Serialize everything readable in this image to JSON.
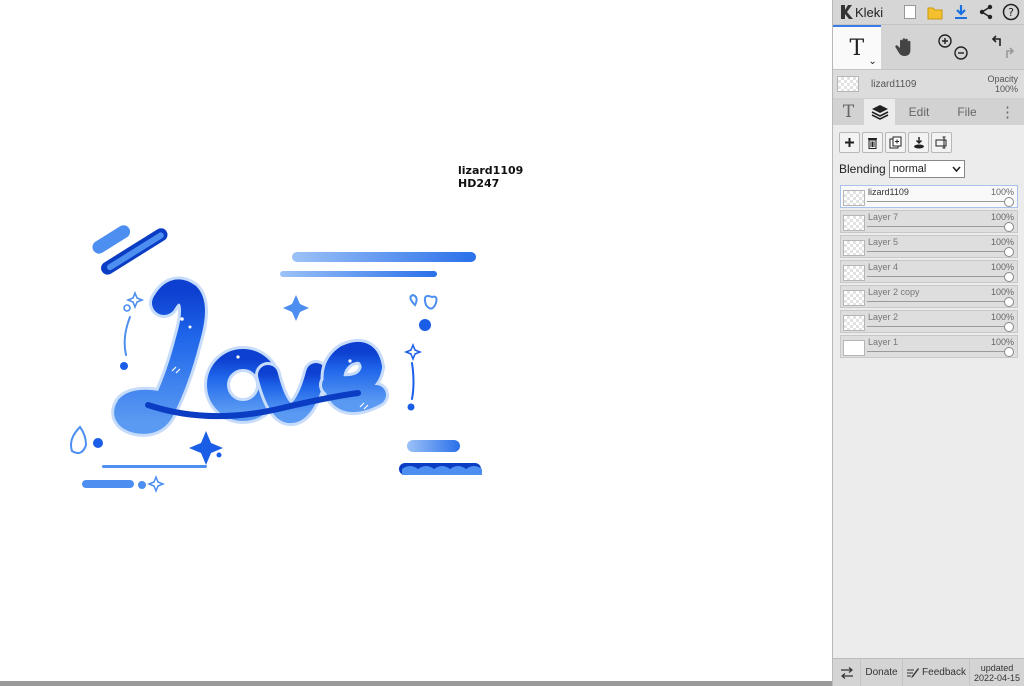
{
  "app": {
    "name": "Kleki",
    "icons": [
      "logo-icon",
      "new-image-icon",
      "save-icon",
      "export-icon",
      "share-icon",
      "help-icon"
    ]
  },
  "canvas": {
    "text_lines": [
      "lizard1109",
      "HD247"
    ],
    "artwork_word": "Love",
    "colors": {
      "primary": "#1a5ee8",
      "light": "#4d8ff0",
      "dark": "#0a3cc4",
      "pale": "#8fb8f5"
    }
  },
  "tools": {
    "text_tool_label": "T",
    "caret": "⌄",
    "items": [
      "text-tool",
      "hand-tool",
      "zoom-controls",
      "undo-redo"
    ]
  },
  "current_layer": {
    "name": "lizard1109",
    "opacity_label": "Opacity",
    "opacity_value": "100%"
  },
  "tabs": {
    "brush_label": "T",
    "edit_label": "Edit",
    "file_label": "File",
    "more_label": "⋮"
  },
  "layers_panel": {
    "blending_label": "Blending",
    "blending_mode": "normal",
    "layers": [
      {
        "name": "lizard1109",
        "opacity": "100%",
        "opacity_fraction": 1.0,
        "selected": true
      },
      {
        "name": "Layer 7",
        "opacity": "100%",
        "opacity_fraction": 1.0,
        "selected": false
      },
      {
        "name": "Layer 5",
        "opacity": "100%",
        "opacity_fraction": 1.0,
        "selected": false
      },
      {
        "name": "Layer 4",
        "opacity": "100%",
        "opacity_fraction": 1.0,
        "selected": false
      },
      {
        "name": "Layer 2 copy",
        "opacity": "100%",
        "opacity_fraction": 1.0,
        "selected": false
      },
      {
        "name": "Layer 2",
        "opacity": "100%",
        "opacity_fraction": 1.0,
        "selected": false
      },
      {
        "name": "Layer 1",
        "opacity": "100%",
        "opacity_fraction": 1.0,
        "selected": false
      }
    ]
  },
  "bottom": {
    "donate_label": "Donate",
    "feedback_label": "Feedback",
    "updated_label": "updated",
    "updated_date": "2022-04-15"
  },
  "colors": {
    "accent": "#3b7de8",
    "panel_bg": "#dcdcdc",
    "tab_bg": "#ececec"
  }
}
